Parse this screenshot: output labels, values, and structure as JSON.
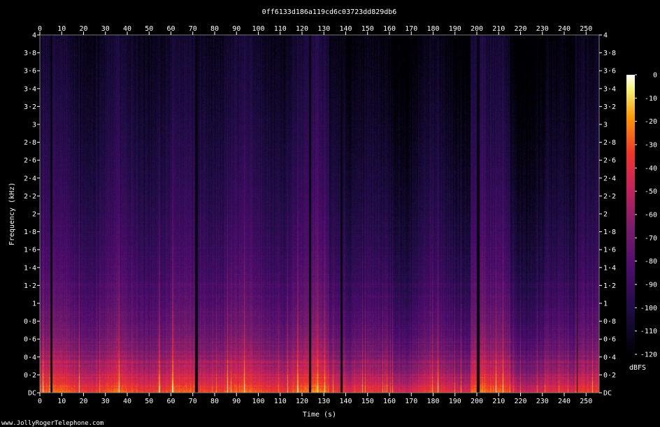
{
  "chart_data": {
    "type": "heatmap",
    "title": "0ff6133d186a119cd6c03723dd829db6",
    "xlabel": "Time (s)",
    "ylabel": "Frequency (kHz)",
    "xlim": [
      0,
      256
    ],
    "ylim": [
      0,
      4
    ],
    "x_ticks": [
      0,
      10,
      20,
      30,
      40,
      50,
      60,
      70,
      80,
      90,
      100,
      110,
      120,
      130,
      140,
      150,
      160,
      170,
      180,
      190,
      200,
      210,
      220,
      230,
      240,
      250
    ],
    "y_ticks": [
      "DC",
      "0·2",
      "0·4",
      "0·6",
      "0·8",
      "1",
      "1·2",
      "1·4",
      "1·6",
      "1·8",
      "2",
      "2·2",
      "2·4",
      "2·6",
      "2·8",
      "3",
      "3·2",
      "3·4",
      "3·6",
      "3·8",
      "4"
    ],
    "colorbar": {
      "label": "dBFS",
      "ticks": [
        "0",
        "-10",
        "-20",
        "-30",
        "-40",
        "-50",
        "-60",
        "-70",
        "-80",
        "-90",
        "-100",
        "-110",
        "-120"
      ],
      "range": [
        -120,
        0
      ],
      "colormap": "inferno"
    },
    "grid": false
  },
  "footer": {
    "watermark": "www.JollyRogerTelephone.com"
  },
  "colors": {
    "background": "#000000",
    "text": "#ffffff"
  }
}
